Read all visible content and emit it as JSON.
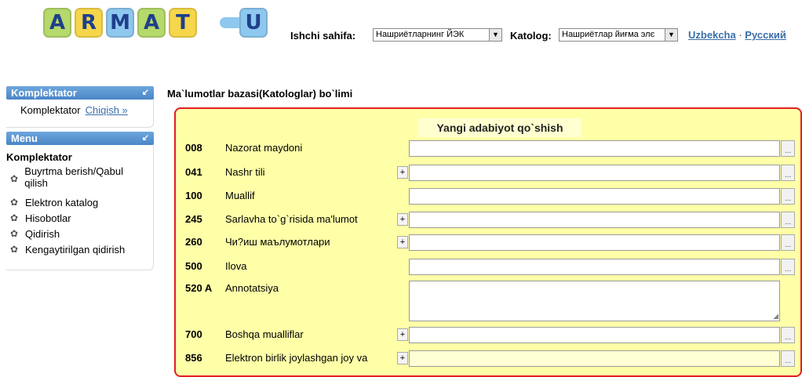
{
  "logo": {
    "letters": [
      "A",
      "R",
      "M",
      "A",
      "T",
      "U"
    ]
  },
  "header": {
    "work_page_label": "Ishchi sahifa:",
    "work_page_value": "Нашриётларнинг ЙЭК",
    "catalog_label": "Katolog:",
    "catalog_value": "Нашриётлар йиғма элє",
    "lang_uz": "Uzbekcha",
    "lang_sep": "·",
    "lang_ru": "Русский"
  },
  "sidebar": {
    "panel1_title": "Komplektator",
    "user_label": "Komplektator",
    "logout_link": "Chiqish »",
    "panel2_title": "Menu",
    "menu_heading": "Komplektator",
    "items": [
      {
        "label": "Buyrtma berish/Qabul qilish"
      },
      {
        "label": "Elektron katalog"
      },
      {
        "label": "Hisobotlar"
      },
      {
        "label": "Qidirish"
      },
      {
        "label": "Kengaytirilgan qidirish"
      }
    ]
  },
  "main": {
    "title": "Ma`lumotlar bazasi(Katologlar) bo`limi",
    "form_caption": "Yangi adabiyot qo`shish",
    "rows": [
      {
        "tag": "008",
        "label": "Nazorat maydoni"
      },
      {
        "tag": "041",
        "label": "Nashr tili"
      },
      {
        "tag": "100",
        "label": "Muallif"
      },
      {
        "tag": "245",
        "label": "Sarlavha to`g`risida ma'lumot"
      },
      {
        "tag": "260",
        "label": "Чи?иш маълумотлари"
      },
      {
        "tag": "500",
        "label": "Ilova"
      },
      {
        "tag": "520 A",
        "label": "Annotatsiya"
      },
      {
        "tag": "700",
        "label": "Boshqa mualliflar"
      },
      {
        "tag": "856",
        "label": "Elektron birlik joylashgan joy va"
      }
    ],
    "plus_label": "+",
    "browse_label": "..."
  },
  "colors": {
    "form_bg": "#ffffa8",
    "form_border": "#e02020",
    "panel_header": "#4a86c7",
    "link": "#3a6fa8"
  }
}
